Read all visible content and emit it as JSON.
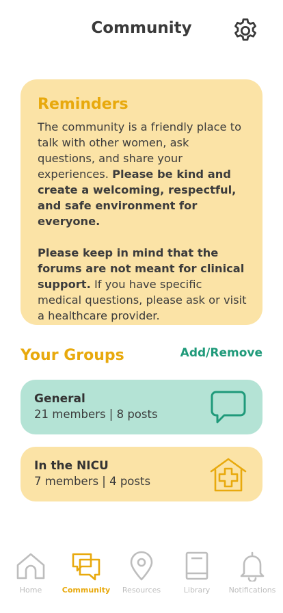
{
  "header": {
    "title": "Community",
    "settings_icon": "gear-icon"
  },
  "reminders": {
    "title": "Reminders",
    "p1_text": "The community is a friendly place to talk with other women, ask questions, and share your experiences. ",
    "p1_bold": "Please be kind and create a welcoming, respectful, and safe environment for everyone.",
    "p2_bold": "Please keep in mind that the forums are not meant for clinical support.",
    "p2_text": " If you have specific medical questions, please ask or visit a healthcare provider."
  },
  "groups": {
    "title": "Your Groups",
    "add_remove_label": "Add/Remove",
    "items": [
      {
        "name": "General",
        "stats": "21 members | 8 posts",
        "icon": "chat-bubble-icon",
        "color": "#b4e3d5"
      },
      {
        "name": "In the NICU",
        "stats": "7 members | 4 posts",
        "icon": "hospital-icon",
        "color": "#fbe3a6"
      }
    ]
  },
  "tabbar": {
    "items": [
      {
        "label": "Home",
        "icon": "home-icon",
        "active": false
      },
      {
        "label": "Community",
        "icon": "community-chat-icon",
        "active": true
      },
      {
        "label": "Resources",
        "icon": "location-pin-icon",
        "active": false
      },
      {
        "label": "Library",
        "icon": "book-icon",
        "active": false
      },
      {
        "label": "Notifications",
        "icon": "bell-icon",
        "active": false
      }
    ]
  },
  "colors": {
    "accent": "#e8a90d",
    "teal": "#1f9a7a",
    "inactive": "#bdbdbd",
    "card_yellow": "#fbe3a6",
    "card_teal": "#b4e3d5"
  }
}
